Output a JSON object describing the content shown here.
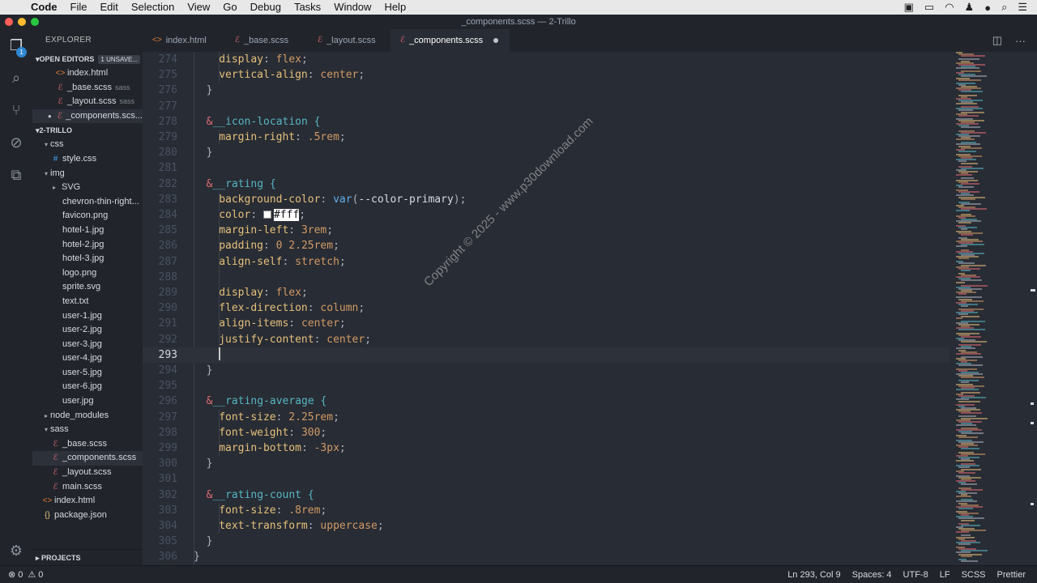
{
  "menubar": {
    "app": "Code",
    "items": [
      "File",
      "Edit",
      "Selection",
      "View",
      "Go",
      "Debug",
      "Tasks",
      "Window",
      "Help"
    ]
  },
  "window": {
    "title": "_components.scss — 2-Trillo"
  },
  "activity": {
    "explorer_badge": "1"
  },
  "sidebar": {
    "header": "EXPLORER",
    "open_editors": {
      "label": "OPEN EDITORS",
      "unsaved": "1 UNSAVE..."
    },
    "open_files": [
      {
        "name": "index.html",
        "hint": "",
        "icon": "html-icon"
      },
      {
        "name": "_base.scss",
        "hint": "sass",
        "icon": "sass-icon"
      },
      {
        "name": "_layout.scss",
        "hint": "sass",
        "icon": "sass-icon"
      },
      {
        "name": "_components.scs...",
        "hint": "",
        "icon": "sass-icon"
      }
    ],
    "project_label": "2-TRILLO",
    "tree": {
      "css": "css",
      "style_css": "style.css",
      "img": "img",
      "svg": "SVG",
      "img_files": [
        "chevron-thin-right...",
        "favicon.png",
        "hotel-1.jpg",
        "hotel-2.jpg",
        "hotel-3.jpg",
        "logo.png",
        "sprite.svg",
        "text.txt",
        "user-1.jpg",
        "user-2.jpg",
        "user-3.jpg",
        "user-4.jpg",
        "user-5.jpg",
        "user-6.jpg",
        "user.jpg"
      ],
      "node_modules": "node_modules",
      "sass": "sass",
      "sass_files": [
        "_base.scss",
        "_components.scss",
        "_layout.scss",
        "main.scss"
      ],
      "index_html": "index.html",
      "package_json": "package.json"
    },
    "projects_label": "PROJECTS"
  },
  "tabs": [
    {
      "label": "index.html",
      "icon": "html-icon"
    },
    {
      "label": "_base.scss",
      "icon": "sass-icon"
    },
    {
      "label": "_layout.scss",
      "icon": "sass-icon"
    },
    {
      "label": "_components.scss",
      "icon": "sass-icon"
    }
  ],
  "editor": {
    "line_numbers": [
      "274",
      "275",
      "276",
      "277",
      "278",
      "279",
      "280",
      "281",
      "282",
      "283",
      "284",
      "285",
      "286",
      "287",
      "288",
      "289",
      "290",
      "291",
      "292",
      "293",
      "294",
      "295",
      "296",
      "297",
      "298",
      "299",
      "300",
      "301",
      "302",
      "303",
      "304",
      "305",
      "306"
    ],
    "tokens": {
      "display": "display",
      "flex": "flex",
      "vertical_align": "vertical-align",
      "center": "center",
      "amp": "&",
      "icon_location": "__icon-location",
      "brace_open": " {",
      "brace_close": "}",
      "margin_right": "margin-right",
      "dot5rem": ".5rem",
      "rating": "__rating",
      "background_color": "background-color",
      "var_fn": "var",
      "var_arg": "--color-primary",
      "color": "color",
      "fff": "#fff",
      "margin_left": "margin-left",
      "three_rem": "3rem",
      "padding": "padding",
      "padding_val": "0 2.25rem",
      "align_self": "align-self",
      "stretch": "stretch",
      "flex_direction": "flex-direction",
      "column": "column",
      "align_items": "align-items",
      "justify_content": "justify-content",
      "rating_average": "__rating-average",
      "font_size": "font-size",
      "two25rem": "2.25rem",
      "font_weight": "font-weight",
      "three_hundred": "300",
      "margin_bottom": "margin-bottom",
      "neg3px": "-3px",
      "rating_count": "__rating-count",
      "dot8rem": ".8rem",
      "text_transform": "text-transform",
      "uppercase": "uppercase",
      "colon": ": ",
      "semi": ";",
      "paren_open": "(",
      "paren_close": ")"
    }
  },
  "watermark": "Copyright © 2025 - www.p30download.com",
  "statusbar": {
    "errors": "⊗ 0",
    "warnings": "⚠ 0",
    "position": "Ln 293, Col 9",
    "spaces": "Spaces: 4",
    "encoding": "UTF-8",
    "eol": "LF",
    "language": "SCSS",
    "formatter": "Prettier"
  },
  "colors": {
    "editor_bg": "#282c34",
    "sidebar_bg": "#21252b",
    "property": "#e5c07b",
    "value": "#d19a66",
    "selector": "#e06c75",
    "class": "#56b6c2",
    "function": "#61afef"
  }
}
